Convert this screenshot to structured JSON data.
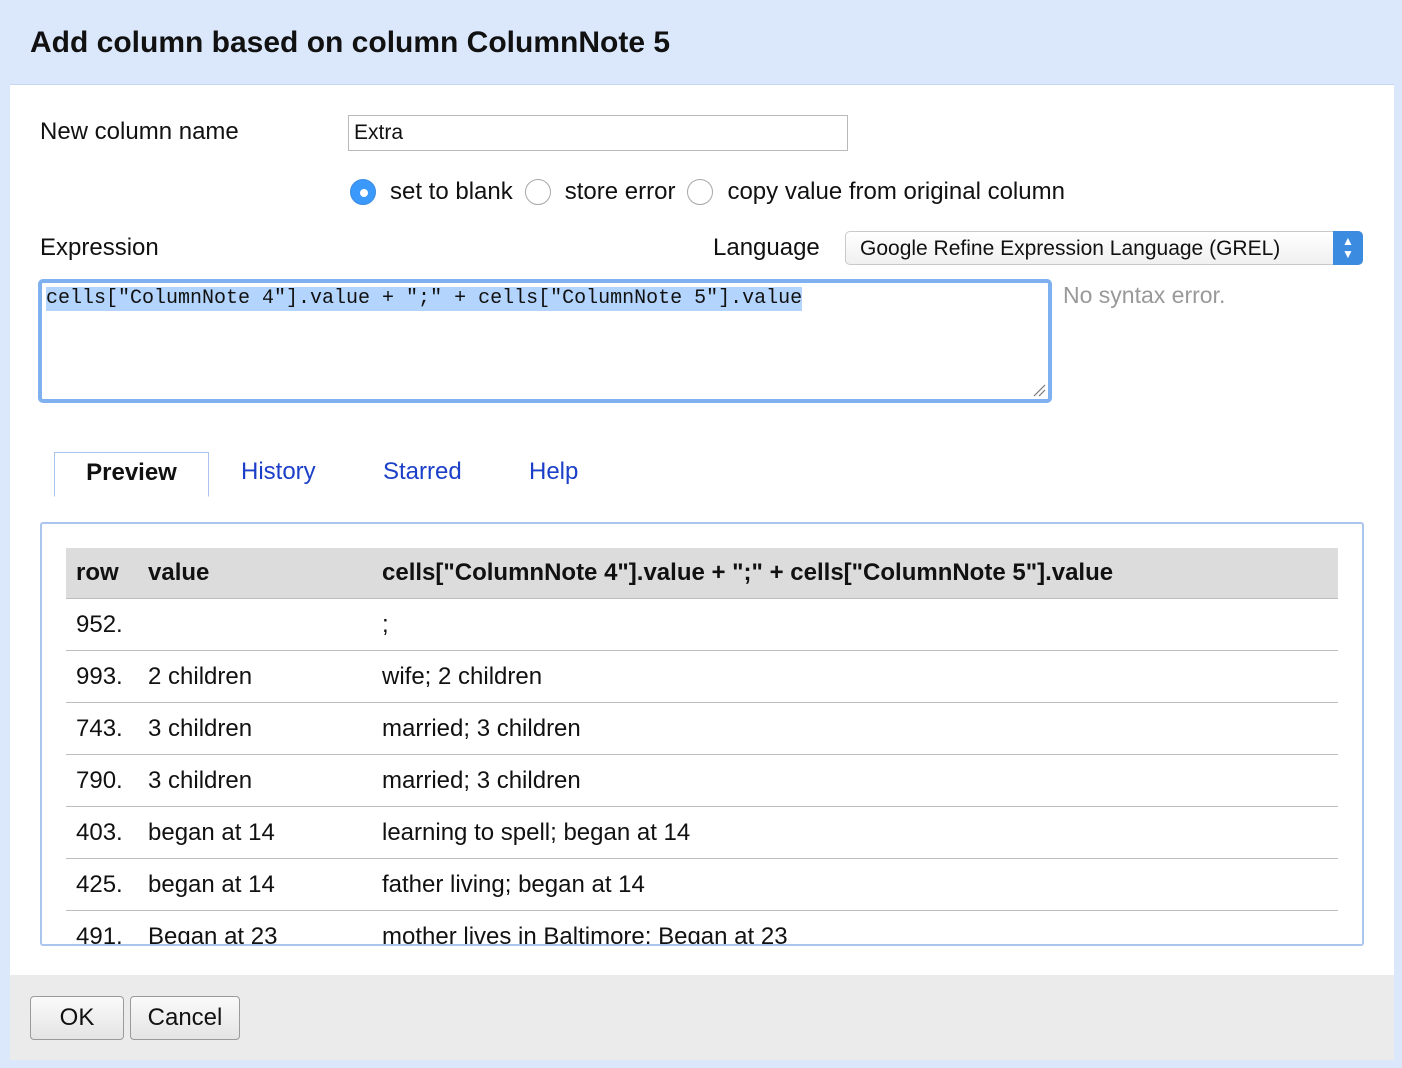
{
  "dialog": {
    "title": "Add column based on column ColumnNote 5"
  },
  "form": {
    "new_column_label": "New column name",
    "new_column_value": "Extra",
    "on_error_options": [
      {
        "label": "set to blank",
        "checked": true
      },
      {
        "label": "store error",
        "checked": false
      },
      {
        "label": "copy value from original column",
        "checked": false
      }
    ],
    "expression_label": "Expression",
    "language_label": "Language",
    "language_value": "Google Refine Expression Language (GREL)",
    "expression": "cells[\"ColumnNote 4\"].value + \";\" + cells[\"ColumnNote 5\"].value",
    "status": "No syntax error."
  },
  "tabs": [
    {
      "label": "Preview",
      "active": true
    },
    {
      "label": "History",
      "active": false
    },
    {
      "label": "Starred",
      "active": false
    },
    {
      "label": "Help",
      "active": false
    }
  ],
  "preview": {
    "headers": [
      "row",
      "value",
      "cells[\"ColumnNote 4\"].value + \";\" + cells[\"ColumnNote 5\"].value"
    ],
    "rows": [
      [
        "952.",
        "",
        ";"
      ],
      [
        "993.",
        "2 children",
        "wife; 2 children"
      ],
      [
        "743.",
        "3 children",
        "married; 3 children"
      ],
      [
        "790.",
        "3 children",
        "married; 3 children"
      ],
      [
        "403.",
        "began at 14",
        "learning to spell; began at 14"
      ],
      [
        "425.",
        "began at 14",
        "father living; began at 14"
      ],
      [
        "491.",
        "Began at 23",
        "mother lives in Baltimore; Began at 23"
      ]
    ]
  },
  "footer": {
    "ok_label": "OK",
    "cancel_label": "Cancel"
  },
  "colors": {
    "title_bar": "#dbe8fb",
    "accent": "#3b99fc",
    "link": "#1b3fc8",
    "selection": "#b3d4fc"
  }
}
